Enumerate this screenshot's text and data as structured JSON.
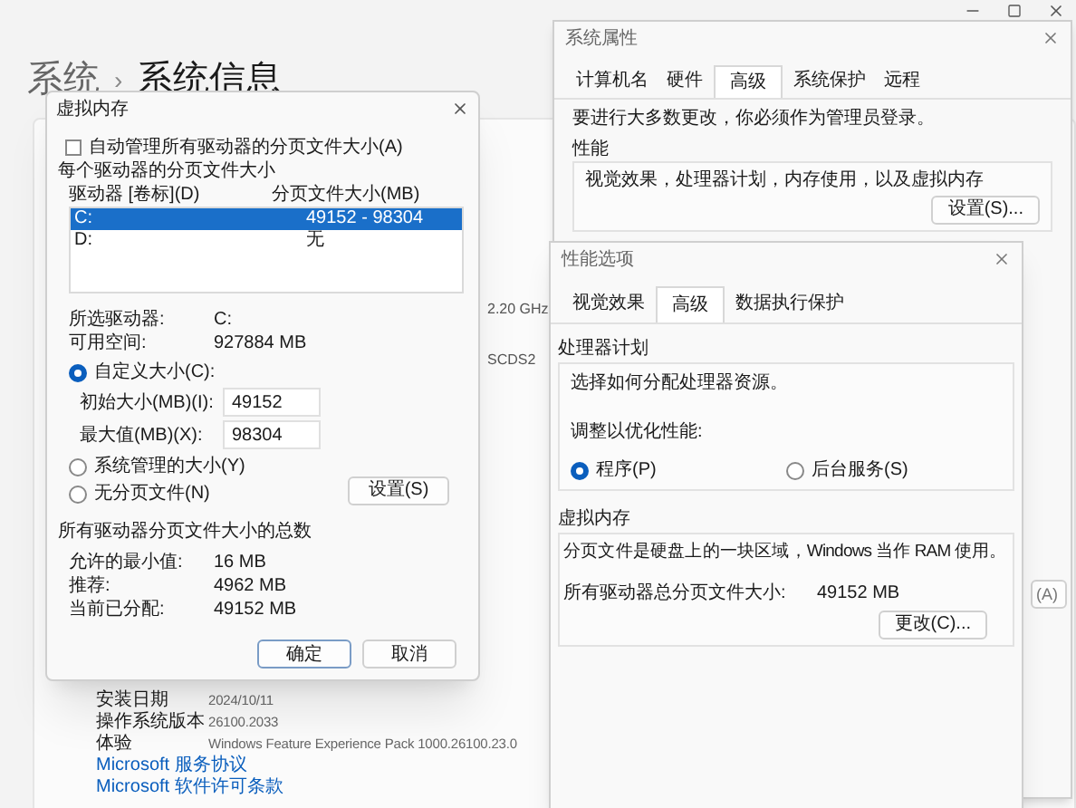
{
  "settings": {
    "breadcrumb_parent": "系统",
    "separator": "›",
    "title": "系统信息",
    "fragments": [
      "2.20 GHz",
      "SCDS2"
    ],
    "info_rows": [
      {
        "label": "安装日期",
        "value": "2024/10/11"
      },
      {
        "label": "操作系统版本",
        "value": "26100.2033"
      },
      {
        "label": "体验",
        "value": "Windows Feature Experience Pack 1000.26100.23.0"
      }
    ],
    "links": [
      "Microsoft 服务协议",
      "Microsoft 软件许可条款"
    ]
  },
  "system_properties": {
    "title": "系统属性",
    "tabs": [
      {
        "label": "计算机名",
        "selected": false
      },
      {
        "label": "硬件",
        "selected": false
      },
      {
        "label": "高级",
        "selected": true
      },
      {
        "label": "系统保护",
        "selected": false
      },
      {
        "label": "远程",
        "selected": false
      }
    ],
    "notice": "要进行大多数更改，你必须作为管理员登录。",
    "performance": {
      "heading": "性能",
      "description": "视觉效果，处理器计划，内存使用，以及虚拟内存",
      "button": "设置(S)..."
    },
    "partial_button": "(A)"
  },
  "performance_options": {
    "title": "性能选项",
    "tabs": [
      {
        "label": "视觉效果",
        "selected": false
      },
      {
        "label": "高级",
        "selected": true
      },
      {
        "label": "数据执行保护",
        "selected": false
      }
    ],
    "processor": {
      "heading": "处理器计划",
      "description": "选择如何分配处理器资源。",
      "prompt": "调整以优化性能:",
      "options": [
        {
          "label": "程序(P)",
          "selected": true
        },
        {
          "label": "后台服务(S)",
          "selected": false
        }
      ]
    },
    "virtual_memory": {
      "heading": "虚拟内存",
      "description": "分页文件是硬盘上的一块区域，Windows 当作 RAM 使用。",
      "total_label": "所有驱动器总分页文件大小:",
      "total_value": "49152 MB",
      "button": "更改(C)..."
    }
  },
  "virtual_memory": {
    "title": "虚拟内存",
    "auto_manage": {
      "label": "自动管理所有驱动器的分页文件大小(A)",
      "checked": false
    },
    "group_label": "每个驱动器的分页文件大小",
    "columns": [
      "驱动器 [卷标](D)",
      "分页文件大小(MB)"
    ],
    "drives": [
      {
        "drive": "C:",
        "size": "49152 - 98304",
        "selected": true
      },
      {
        "drive": "D:",
        "size": "无",
        "selected": false
      }
    ],
    "selected_drive": {
      "label": "所选驱动器:",
      "value": "C:"
    },
    "free_space": {
      "label": "可用空间:",
      "value": "927884 MB"
    },
    "custom": {
      "label": "自定义大小(C):",
      "selected": true
    },
    "initial": {
      "label": "初始大小(MB)(I):",
      "value": "49152"
    },
    "maximum": {
      "label": "最大值(MB)(X):",
      "value": "98304"
    },
    "system_managed": {
      "label": "系统管理的大小(Y)",
      "selected": false
    },
    "no_paging": {
      "label": "无分页文件(N)",
      "selected": false
    },
    "set_button": "设置(S)",
    "totals_heading": "所有驱动器分页文件大小的总数",
    "totals": [
      {
        "label": "允许的最小值:",
        "value": "16 MB"
      },
      {
        "label": "推荐:",
        "value": "4962 MB"
      },
      {
        "label": "当前已分配:",
        "value": "49152 MB"
      }
    ],
    "buttons": [
      {
        "label": "确定",
        "kind": "primary"
      },
      {
        "label": "取消",
        "kind": "secondary"
      }
    ]
  }
}
